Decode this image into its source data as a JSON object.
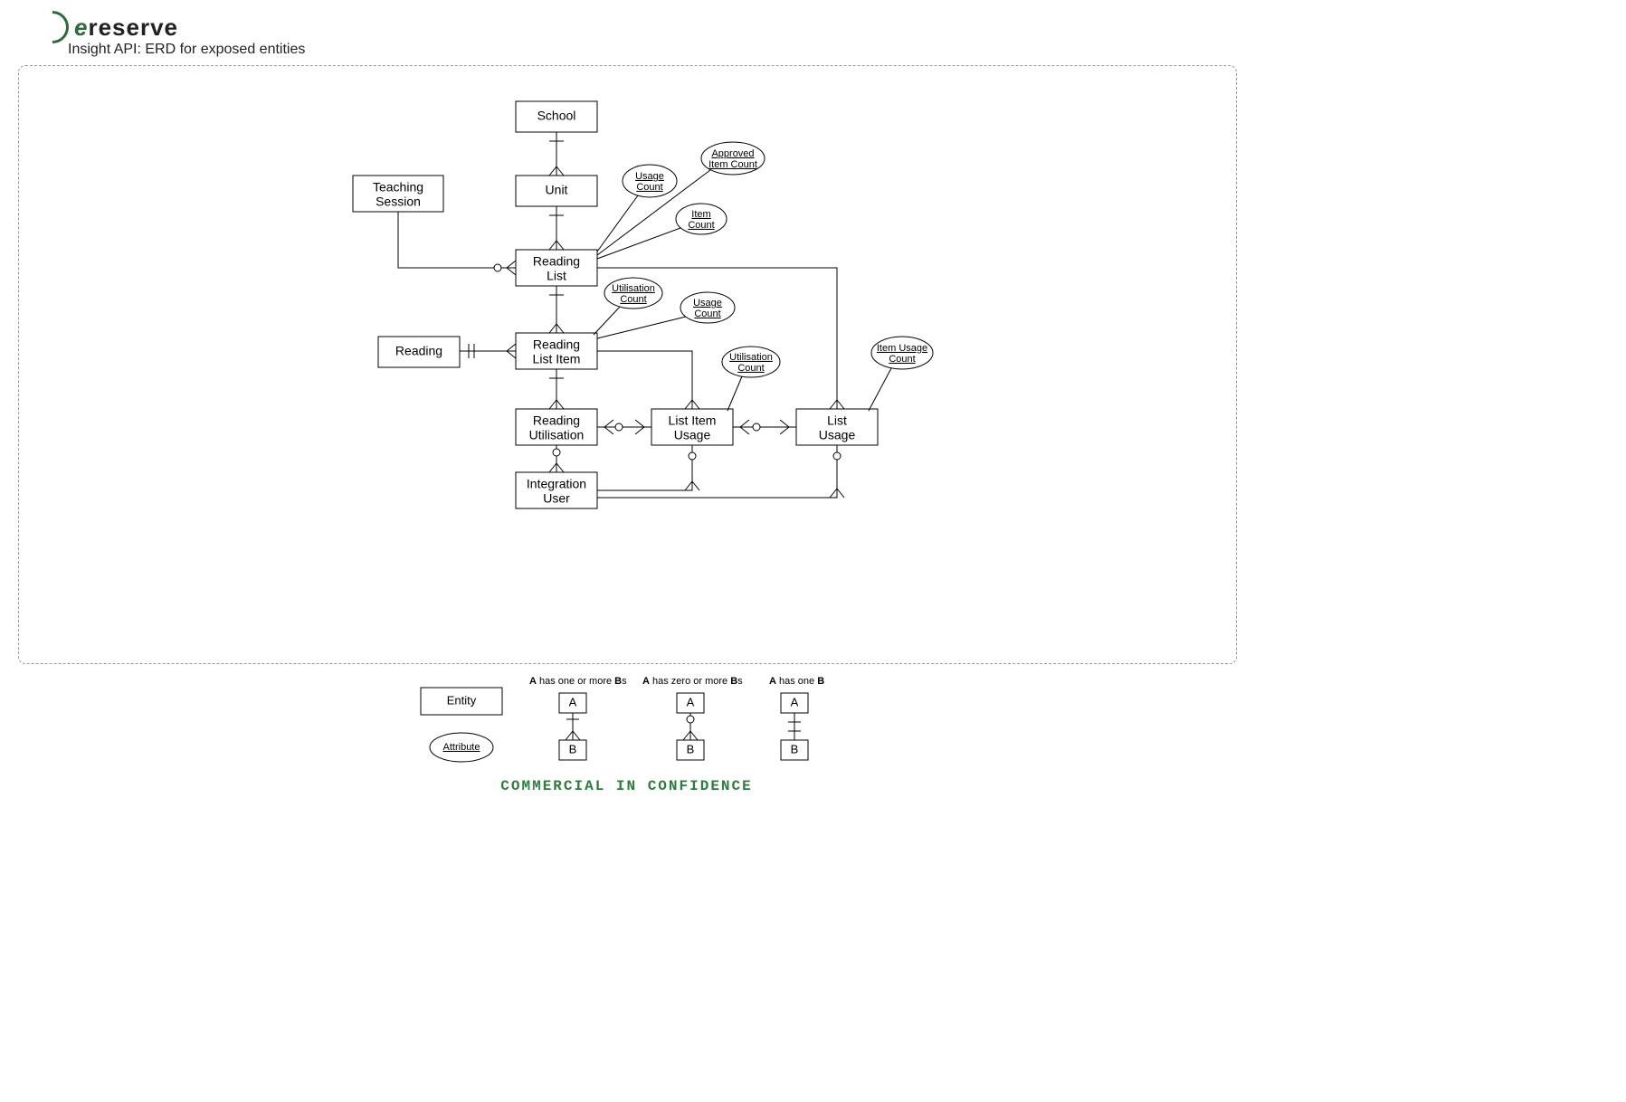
{
  "brand": {
    "e": "e",
    "rest": "reserve"
  },
  "subtitle": "Insight API: ERD for exposed entities",
  "footer": "COMMERCIAL IN CONFIDENCE",
  "entities": {
    "school": "School",
    "teaching_session_l1": "Teaching",
    "teaching_session_l2": "Session",
    "unit": "Unit",
    "reading_list_l1": "Reading",
    "reading_list_l2": "List",
    "reading": "Reading",
    "reading_list_item_l1": "Reading",
    "reading_list_item_l2": "List Item",
    "reading_utilisation_l1": "Reading",
    "reading_utilisation_l2": "Utilisation",
    "list_item_usage_l1": "List Item",
    "list_item_usage_l2": "Usage",
    "list_usage_l1": "List",
    "list_usage_l2": "Usage",
    "integration_user_l1": "Integration",
    "integration_user_l2": "User"
  },
  "attributes": {
    "rl_usage_count_l1": "Usage",
    "rl_usage_count_l2": "Count",
    "rl_approved_item_count_l1": "Approved",
    "rl_approved_item_count_l2": "Item Count",
    "rl_item_count_l1": "Item",
    "rl_item_count_l2": "Count",
    "rli_utilisation_count_l1": "Utilisation",
    "rli_utilisation_count_l2": "Count",
    "rli_usage_count_l1": "Usage",
    "rli_usage_count_l2": "Count",
    "liu_utilisation_count_l1": "Utilisation",
    "liu_utilisation_count_l2": "Count",
    "lu_item_usage_count_l1": "Item Usage",
    "lu_item_usage_count_l2": "Count"
  },
  "legend": {
    "entity": "Entity",
    "attribute": "Attribute",
    "one_or_more_pre": "A",
    "one_or_more_mid": " has one or more ",
    "one_or_more_b": "B",
    "one_or_more_post": "s",
    "zero_or_more_pre": "A",
    "zero_or_more_mid": " has zero or more ",
    "zero_or_more_b": "B",
    "zero_or_more_post": "s",
    "has_one_pre": "A",
    "has_one_mid": " has one ",
    "has_one_b": "B",
    "a": "A",
    "b": "B"
  },
  "diagram_data": {
    "entities": [
      {
        "id": "school",
        "label": "School"
      },
      {
        "id": "teaching_session",
        "label": "Teaching Session"
      },
      {
        "id": "unit",
        "label": "Unit"
      },
      {
        "id": "reading_list",
        "label": "Reading List",
        "derived_attributes": [
          "Usage Count",
          "Approved Item Count",
          "Item Count"
        ]
      },
      {
        "id": "reading",
        "label": "Reading"
      },
      {
        "id": "reading_list_item",
        "label": "Reading List Item",
        "derived_attributes": [
          "Utilisation Count",
          "Usage Count"
        ]
      },
      {
        "id": "reading_utilisation",
        "label": "Reading Utilisation"
      },
      {
        "id": "list_item_usage",
        "label": "List Item Usage",
        "derived_attributes": [
          "Utilisation Count"
        ]
      },
      {
        "id": "list_usage",
        "label": "List Usage",
        "derived_attributes": [
          "Item Usage Count"
        ]
      },
      {
        "id": "integration_user",
        "label": "Integration User"
      }
    ],
    "relationships": [
      {
        "from": "school",
        "to": "unit",
        "cardinality": "one-to-many-mandatory"
      },
      {
        "from": "unit",
        "to": "reading_list",
        "cardinality": "one-to-many-mandatory"
      },
      {
        "from": "teaching_session",
        "to": "reading_list",
        "cardinality": "one-to-many-optional"
      },
      {
        "from": "reading_list",
        "to": "reading_list_item",
        "cardinality": "one-to-many-mandatory"
      },
      {
        "from": "reading",
        "to": "reading_list_item",
        "cardinality": "one-to-many-mandatory"
      },
      {
        "from": "reading_list_item",
        "to": "reading_utilisation",
        "cardinality": "one-to-many-mandatory"
      },
      {
        "from": "reading_list_item",
        "to": "list_item_usage",
        "cardinality": "one-to-many-mandatory"
      },
      {
        "from": "reading_list",
        "to": "list_usage",
        "cardinality": "one-to-many-mandatory"
      },
      {
        "from": "reading_utilisation",
        "to": "list_item_usage",
        "cardinality": "one-to-many-optional"
      },
      {
        "from": "list_item_usage",
        "to": "list_usage",
        "cardinality": "one-to-many-optional"
      },
      {
        "from": "integration_user",
        "to": "reading_utilisation",
        "cardinality": "one-to-many-mandatory"
      },
      {
        "from": "integration_user",
        "to": "list_item_usage",
        "cardinality": "one-to-many-mandatory"
      },
      {
        "from": "integration_user",
        "to": "list_usage",
        "cardinality": "one-to-many-mandatory"
      }
    ],
    "legend_notation": [
      {
        "label": "A has one or more Bs",
        "type": "one-to-many-mandatory"
      },
      {
        "label": "A has zero or more Bs",
        "type": "one-to-many-optional"
      },
      {
        "label": "A has one B",
        "type": "one-to-one-mandatory"
      }
    ]
  }
}
